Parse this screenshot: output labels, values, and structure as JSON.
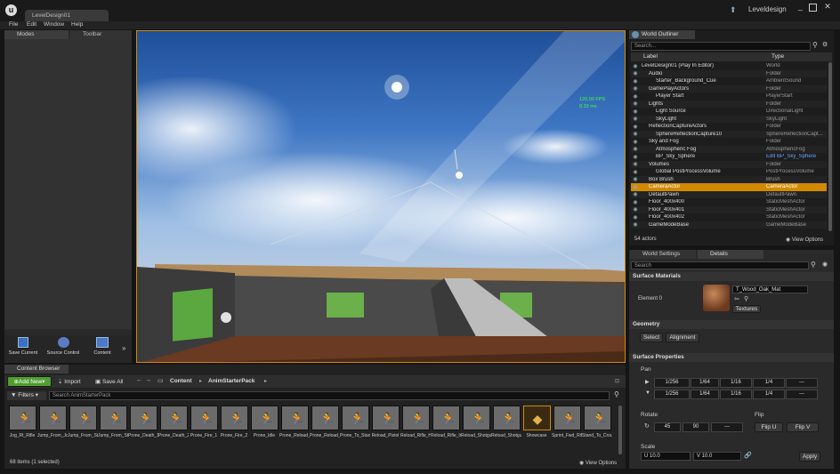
{
  "window": {
    "project_tab": "LevelDesign01",
    "project_name": "Leveldesign",
    "menu": [
      "File",
      "Edit",
      "Window",
      "Help"
    ]
  },
  "modes": {
    "modes_tab": "Modes",
    "toolbar_tab": "Toolbar"
  },
  "toolbar": {
    "save_label": "Save Current",
    "source_label": "Source Control",
    "content_label": "Content"
  },
  "viewport": {
    "fps": "120.00 FPS",
    "ms": "8.33 ms"
  },
  "outliner": {
    "tab": "World Outliner",
    "search_placeholder": "Search...",
    "col_label": "Label",
    "col_type": "Type",
    "rows": [
      {
        "label": "LevelDesign01 (Play In Editor)",
        "type": "World"
      },
      {
        "label": "Audio",
        "type": "Folder"
      },
      {
        "label": "Starter_Background_Cue",
        "type": "AmbientSound"
      },
      {
        "label": "GamePlayActors",
        "type": "Folder"
      },
      {
        "label": "Player Start",
        "type": "PlayerStart"
      },
      {
        "label": "Lights",
        "type": "Folder"
      },
      {
        "label": "Light Source",
        "type": "DirectionalLight"
      },
      {
        "label": "SkyLight",
        "type": "SkyLight"
      },
      {
        "label": "ReflectionCaptureActors",
        "type": "Folder"
      },
      {
        "label": "SphereReflectionCapture10",
        "type": "SphereReflectionCapt..."
      },
      {
        "label": "Sky and Fog",
        "type": "Folder"
      },
      {
        "label": "Atmospheric Fog",
        "type": "AtmosphericFog"
      },
      {
        "label": "BP_Sky_Sphere",
        "type": "Edit BP_Sky_Sphere"
      },
      {
        "label": "Volumes",
        "type": "Folder"
      },
      {
        "label": "Global PostProcessVolume",
        "type": "PostProcessVolume"
      },
      {
        "label": "Box Brush",
        "type": "Brush"
      },
      {
        "label": "CameraActor",
        "type": "CameraActor"
      },
      {
        "label": "DefaultPawn",
        "type": "DefaultPawn"
      },
      {
        "label": "Floor_400x400",
        "type": "StaticMeshActor"
      },
      {
        "label": "Floor_400x401",
        "type": "StaticMeshActor"
      },
      {
        "label": "Floor_400x402",
        "type": "StaticMeshActor"
      },
      {
        "label": "GameModeBase",
        "type": "GameModeBase"
      }
    ],
    "count": "54 actors",
    "view_options": "View Options"
  },
  "details": {
    "world_settings_tab": "World Settings",
    "details_tab": "Details",
    "search_placeholder": "Search",
    "surface_materials": "Surface Materials",
    "element_label": "Element 0",
    "material_name": "T_Wood_Oak_Mat",
    "textures_btn": "Textures",
    "geometry": "Geometry",
    "select_btn": "Select",
    "alignment_btn": "Alignment",
    "surface_props": "Surface Properties",
    "pan_label": "Pan",
    "pan_values": [
      "1/256",
      "1/64",
      "1/16",
      "1/4",
      "---"
    ],
    "rotate_label": "Rotate",
    "rotate_values": [
      "45",
      "90",
      "---"
    ],
    "flip_label": "Flip",
    "flip_u": "Flip U",
    "flip_v": "Flip V",
    "scale_label": "Scale",
    "scale_u": "U  10.0",
    "scale_v": "V  10.0",
    "apply_btn": "Apply"
  },
  "content_browser": {
    "tab": "Content Browser",
    "add_new": "Add New",
    "import": "Import",
    "save_all": "Save All",
    "path": [
      "Content",
      "AnimStarterPack"
    ],
    "filters": "Filters",
    "search_placeholder": "Search AnimStarterPack",
    "assets": [
      "Jog_Rt_Rifle",
      "Jump_From_Jog",
      "Jump_From_Stand",
      "Jump_From_Stand_Ironsights",
      "Prone_Death_1",
      "Prone_Death_2",
      "Prone_Fire_1",
      "Prone_Fire_2",
      "Prone_Idle",
      "Prone_Reload_Rifle",
      "Prone_Reload_Shotgun",
      "Prone_To_Stand",
      "Reload_Pistol",
      "Reload_Rifle_Hip",
      "Reload_Rifle_Ironsights",
      "Reload_Shotgun_Hip",
      "Reload_Shotgun_Ironsights",
      "Showcase",
      "Sprint_Fwd_Rifle",
      "Stand_To_Crouch_Rifle_Hip"
    ],
    "count": "68 items (1 selected)",
    "view_options": "View Options"
  },
  "colors": {
    "accent": "#d18a00",
    "link": "#6aa6ff",
    "add_green": "#4f9e2e"
  }
}
